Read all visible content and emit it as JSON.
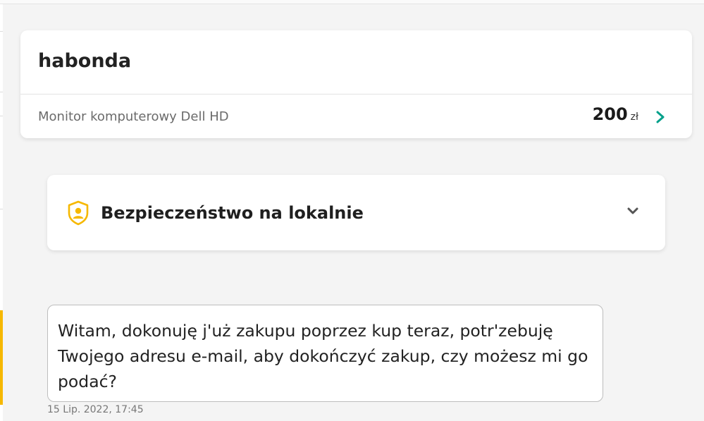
{
  "offer": {
    "seller": "habonda",
    "title": "Monitor komputerowy Dell HD",
    "price": "200",
    "currency": "zł"
  },
  "safety": {
    "title": "Bezpieczeństwo na lokalnie"
  },
  "message": {
    "text": "Witam, dokonuję j'uż zakupu poprzez kup teraz, potr'zebuję Twojego adresu e-mail, aby dokończyć zakup, czy możesz mi go podać?",
    "timestamp": "15 Lip. 2022, 17:45"
  },
  "colors": {
    "accent_yellow": "#f6b800",
    "accent_teal": "#00a08a",
    "card": "#ffffff",
    "background": "#f4f4f4"
  },
  "icons": {
    "offer_link": "chevron-right-icon",
    "safety": "shield-user-icon",
    "safety_toggle": "chevron-down-icon"
  }
}
